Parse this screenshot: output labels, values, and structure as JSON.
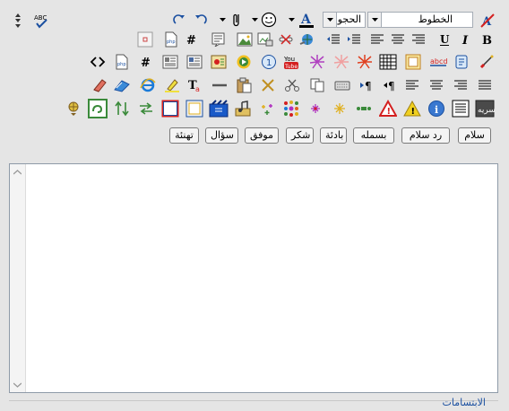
{
  "format_row": {
    "font_select": {
      "value": "الخطوط"
    },
    "size_select": {
      "value": "الحجو"
    }
  },
  "quick_buttons": [
    {
      "label": "سلام"
    },
    {
      "label": "رد سلام"
    },
    {
      "label": "بسمله"
    },
    {
      "label": "بادئة"
    },
    {
      "label": "شكر"
    },
    {
      "label": "موفق"
    },
    {
      "label": "سؤال"
    },
    {
      "label": "تهنئة"
    }
  ],
  "footer": {
    "smilies_label": "الابتسامات"
  },
  "colors": {
    "toolbar_bg": "#e5e5e5",
    "accent_blue": "#1a4fa0",
    "alert_red": "#d42020",
    "font_color_bar": "#000000"
  }
}
